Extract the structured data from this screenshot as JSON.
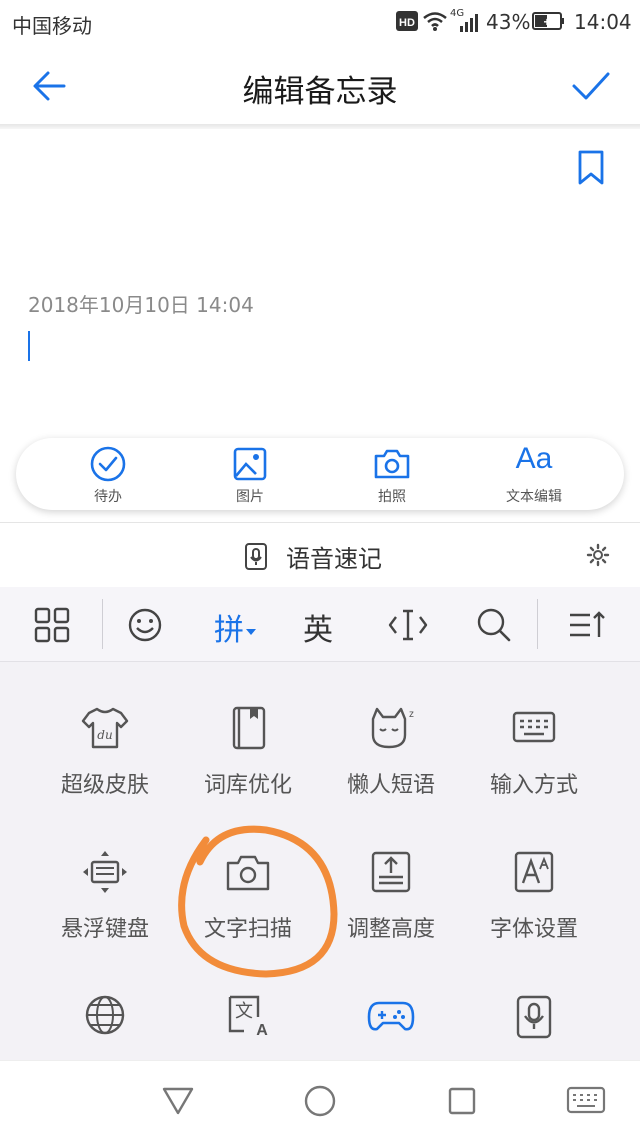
{
  "status_bar": {
    "carrier": "中国移动",
    "battery": "43%",
    "time": "14:04",
    "network": "4G"
  },
  "title_bar": {
    "title": "编辑备忘录"
  },
  "note": {
    "date": "2018年10月10日 14:04"
  },
  "toolbar": [
    {
      "label": "待办",
      "icon": "checkcircle-icon"
    },
    {
      "label": "图片",
      "icon": "image-icon"
    },
    {
      "label": "拍照",
      "icon": "camera-icon"
    },
    {
      "label": "文本编辑",
      "icon": "text-format-icon"
    }
  ],
  "toolbar_glyph": "Aa",
  "voice_note": {
    "label": "语音速记"
  },
  "keyboard_tabs": {
    "pinyin": "拼",
    "english": "英"
  },
  "keyboard_grid": [
    {
      "label": "超级皮肤",
      "icon": "tshirt-icon"
    },
    {
      "label": "词库优化",
      "icon": "book-icon"
    },
    {
      "label": "懒人短语",
      "icon": "lazy-cat-icon"
    },
    {
      "label": "输入方式",
      "icon": "keyboard-icon"
    },
    {
      "label": "悬浮键盘",
      "icon": "floating-keyboard-icon"
    },
    {
      "label": "文字扫描",
      "icon": "camera-icon"
    },
    {
      "label": "调整高度",
      "icon": "adjust-height-icon"
    },
    {
      "label": "字体设置",
      "icon": "font-settings-icon"
    },
    {
      "label": "",
      "icon": "globe-icon"
    },
    {
      "label": "",
      "icon": "translate-icon"
    },
    {
      "label": "",
      "icon": "gamepad-icon"
    },
    {
      "label": "",
      "icon": "voice-note-icon"
    }
  ],
  "colors": {
    "accent": "#1a73e8",
    "annotation": "#f28c3a",
    "keyboard_bg": "#f3f2f6"
  }
}
